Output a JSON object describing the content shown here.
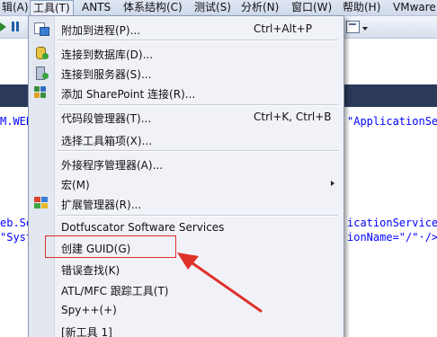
{
  "menubar": {
    "items": [
      {
        "label": "辑(A)"
      },
      {
        "label": "工具(T)"
      },
      {
        "label": "ANTS"
      },
      {
        "label": "体系结构(C)"
      },
      {
        "label": "测试(S)"
      },
      {
        "label": "分析(N)"
      },
      {
        "label": "窗口(W)"
      },
      {
        "label": "帮助(H)"
      },
      {
        "label": "VMware"
      }
    ]
  },
  "editor": {
    "lines": {
      "l1_left": "M.WEB",
      "l1_right": "\"ApplicationSer",
      "l2_left": "eb.Se",
      "l2_right": "icationServices",
      "l3_left": "\"Syst",
      "l3_right": "ionName=\"/\"·/>"
    }
  },
  "tools_menu": {
    "items": [
      {
        "label": "附加到进程(P)...",
        "shortcut": "Ctrl+Alt+P",
        "icon": "attach-process-icon"
      },
      {
        "label": "连接到数据库(D)...",
        "shortcut": "",
        "icon": "database-connect-icon"
      },
      {
        "label": "连接到服务器(S)...",
        "shortcut": "",
        "icon": "server-connect-icon"
      },
      {
        "label": "添加 SharePoint 连接(R)...",
        "shortcut": "",
        "icon": "sharepoint-icon"
      },
      {
        "label": "代码段管理器(T)...",
        "shortcut": "Ctrl+K, Ctrl+B",
        "icon": ""
      },
      {
        "label": "选择工具箱项(X)...",
        "shortcut": "",
        "icon": ""
      },
      {
        "label": "外接程序管理器(A)...",
        "shortcut": "",
        "icon": ""
      },
      {
        "label": "宏(M)",
        "shortcut": "",
        "icon": ""
      },
      {
        "label": "扩展管理器(R)...",
        "shortcut": "",
        "icon": "extension-manager-icon"
      },
      {
        "label": "Dotfuscator Software Services",
        "shortcut": "",
        "icon": ""
      },
      {
        "label": "创建 GUID(G)",
        "shortcut": "",
        "icon": ""
      },
      {
        "label": "错误查找(K)",
        "shortcut": "",
        "icon": ""
      },
      {
        "label": "ATL/MFC 跟踪工具(T)",
        "shortcut": "",
        "icon": ""
      },
      {
        "label": "Spy++(+)",
        "shortcut": "",
        "icon": ""
      },
      {
        "label": "[新工具 1]",
        "shortcut": "",
        "icon": ""
      }
    ]
  },
  "annotation": {
    "color": "#e0302a"
  }
}
